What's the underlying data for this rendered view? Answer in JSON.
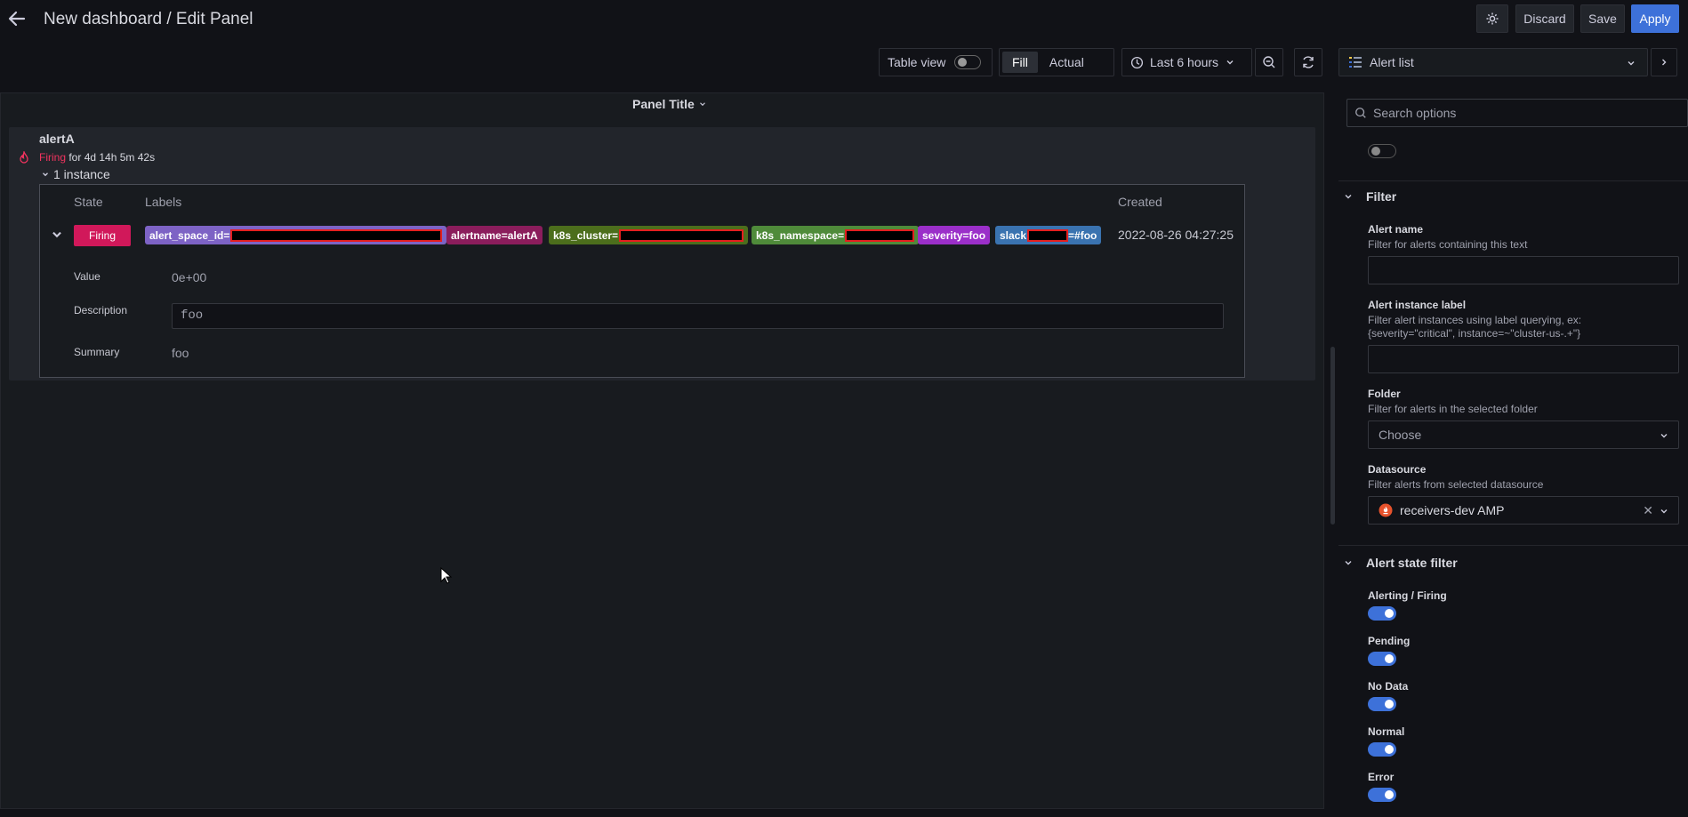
{
  "header": {
    "title": "New dashboard / Edit Panel",
    "discard": "Discard",
    "save": "Save",
    "apply": "Apply"
  },
  "toolbar": {
    "table_view": "Table view",
    "fill": "Fill",
    "actual": "Actual",
    "time_range": "Last 6 hours",
    "visualization": "Alert list"
  },
  "panel": {
    "title": "Panel Title",
    "alert": {
      "name": "alertA",
      "state_word": "Firing",
      "duration": " for 4d 14h 5m 42s",
      "instances": "1 instance"
    },
    "table": {
      "col_state": "State",
      "col_labels": "Labels",
      "col_created": "Created",
      "row": {
        "state": "Firing",
        "created": "2022-08-26 04:27:25",
        "labels": [
          {
            "text": "alert_space_id=",
            "color": "#7d63c5"
          },
          {
            "text": "alertname=alertA",
            "color": "#8b1d5c"
          },
          {
            "text": "k8s_cluster=",
            "color": "#4c6e1c"
          },
          {
            "text": "k8s_namespace=",
            "color": "#4f8b3a"
          },
          {
            "text": "severity=foo",
            "color": "#9b2fc9"
          },
          {
            "text": "slack",
            "color": "#3a73b0"
          },
          {
            "text": "=#foo",
            "color": "#3a73b0"
          }
        ]
      }
    },
    "details": {
      "value_label": "Value",
      "value": "0e+00",
      "description_label": "Description",
      "description": "foo",
      "summary_label": "Summary",
      "summary": "foo"
    }
  },
  "options": {
    "search_placeholder": "Search options",
    "filter": {
      "heading": "Filter",
      "alert_name_label": "Alert name",
      "alert_name_desc": "Filter for alerts containing this text",
      "instance_label": "Alert instance label",
      "instance_desc_1": "Filter alert instances using label querying, ex:",
      "instance_desc_2": "{severity=\"critical\", instance=~\"cluster-us-.+\"}",
      "folder_label": "Folder",
      "folder_desc": "Filter for alerts in the selected folder",
      "folder_placeholder": "Choose",
      "datasource_label": "Datasource",
      "datasource_desc": "Filter alerts from selected datasource",
      "datasource_value": "receivers-dev AMP"
    },
    "state_filter": {
      "heading": "Alert state filter",
      "items": [
        "Alerting / Firing",
        "Pending",
        "No Data",
        "Normal",
        "Error"
      ]
    }
  },
  "colors": {
    "accent": "#3d71d9",
    "firing": "#d1185a",
    "background": "#111217",
    "panel": "#181b1f"
  }
}
